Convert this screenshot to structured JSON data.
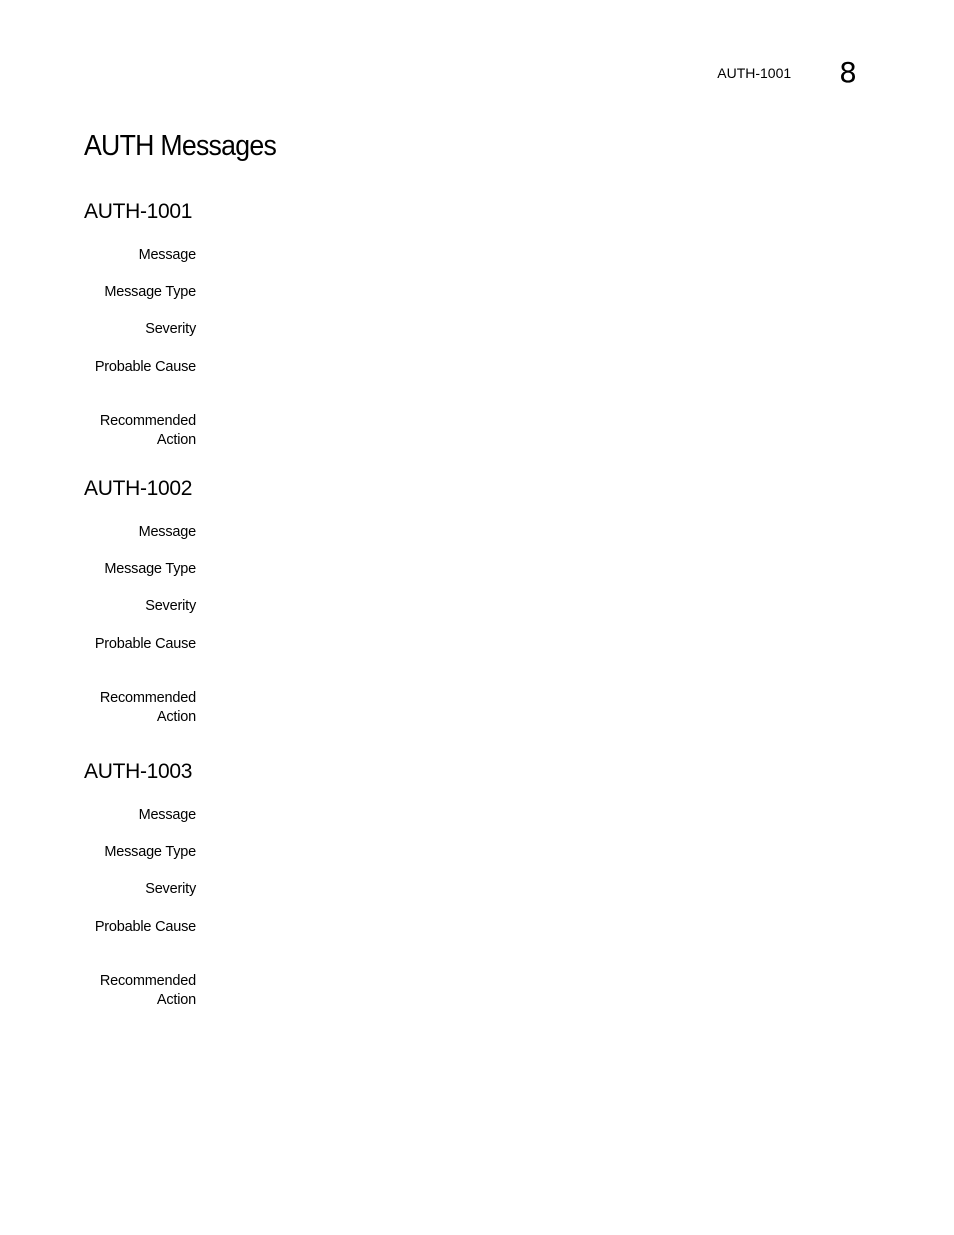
{
  "header": {
    "running_title": "AUTH-1001",
    "chapter_number": "8"
  },
  "page_title": "AUTH Messages",
  "sections": [
    {
      "title": "AUTH-1001",
      "fields": [
        {
          "label": "Message",
          "value": ""
        },
        {
          "label": "Message Type",
          "value": ""
        },
        {
          "label": "Severity",
          "value": ""
        },
        {
          "label": "Probable Cause",
          "value": ""
        },
        {
          "label": "Recommended Action",
          "value": ""
        }
      ]
    },
    {
      "title": "AUTH-1002",
      "fields": [
        {
          "label": "Message",
          "value": ""
        },
        {
          "label": "Message Type",
          "value": ""
        },
        {
          "label": "Severity",
          "value": ""
        },
        {
          "label": "Probable Cause",
          "value": ""
        },
        {
          "label": "Recommended Action",
          "value": ""
        }
      ]
    },
    {
      "title": "AUTH-1003",
      "fields": [
        {
          "label": "Message",
          "value": ""
        },
        {
          "label": "Message Type",
          "value": ""
        },
        {
          "label": "Severity",
          "value": ""
        },
        {
          "label": "Probable Cause",
          "value": ""
        },
        {
          "label": "Recommended Action",
          "value": ""
        }
      ]
    }
  ]
}
